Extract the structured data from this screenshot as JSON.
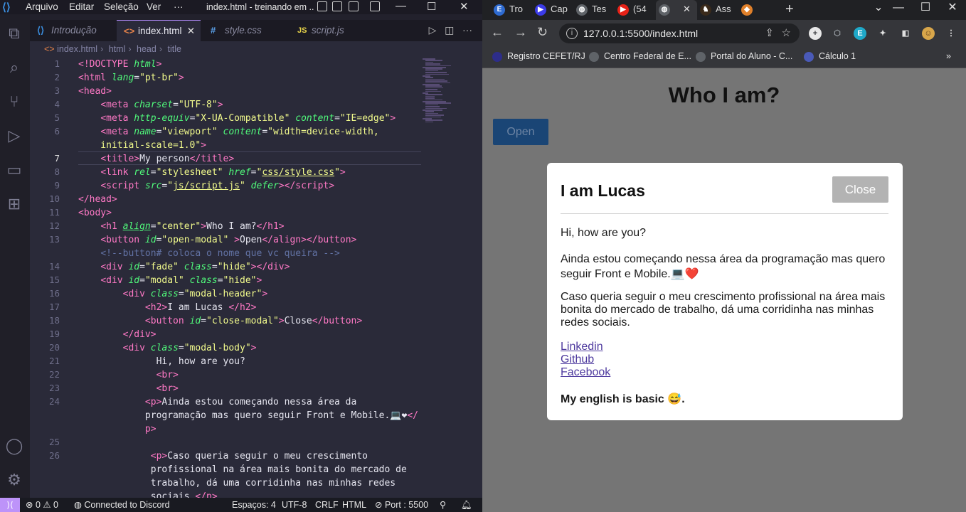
{
  "vscode": {
    "menu": [
      "Arquivo",
      "Editar",
      "Seleção",
      "Ver",
      "···"
    ],
    "window_title": "index.html - treinando em ...",
    "tabs": [
      {
        "label": "Introdução",
        "icon": "vscode-logo-icon"
      },
      {
        "label": "index.html",
        "icon": "html-icon"
      },
      {
        "label": "style.css",
        "icon": "hash-icon"
      },
      {
        "label": "script.js",
        "icon": "js-icon"
      }
    ],
    "tab_icons": {
      "html": "<>",
      "css": "#",
      "js": "JS"
    },
    "breadcrumb": [
      "index.html",
      "html",
      "head",
      "title"
    ],
    "line_numbers": [
      "1",
      "2",
      "3",
      "4",
      "5",
      "6",
      "7",
      "8",
      "9",
      "10",
      "11",
      "12",
      "13",
      "14",
      "15",
      "16",
      "17",
      "18",
      "19",
      "20",
      "21",
      "22",
      "23",
      "24",
      "25",
      "26"
    ],
    "current_line": "7",
    "status": {
      "problems": "⊗ 0 ⚠ 0",
      "discord": "Connected to Discord",
      "spaces": "Espaços: 4",
      "encoding": "UTF-8",
      "eol": "CRLF",
      "language": "HTML",
      "port": "Port : 5500"
    }
  },
  "browser": {
    "tabs": [
      {
        "label": "Tro",
        "color": "#2e6bd1",
        "glyph": "E"
      },
      {
        "label": "Cap",
        "color": "#3b3be8",
        "glyph": "▶"
      },
      {
        "label": "Tes",
        "color": "#5f6368",
        "glyph": "◍"
      },
      {
        "label": "(54",
        "color": "#e62117",
        "glyph": "▶"
      },
      {
        "label": "",
        "color": "#5f6368",
        "glyph": "◍"
      },
      {
        "label": "Ass",
        "color": "#3a2a1a",
        "glyph": "♞"
      },
      {
        "label": "",
        "color": "#e0802a",
        "glyph": "◆"
      }
    ],
    "url": "127.0.0.1:5500/index.html",
    "bookmarks": [
      {
        "label": "Registro CEFET/RJ",
        "color": "#2d2d8a"
      },
      {
        "label": "Centro Federal de E...",
        "color": "#5f6368"
      },
      {
        "label": "Portal do Aluno - C...",
        "color": "#5f6368"
      },
      {
        "label": "Cálculo 1",
        "color": "#4a5ab8"
      }
    ],
    "page": {
      "heading": "Who I am?",
      "open_button": "Open",
      "modal": {
        "title": "I am Lucas",
        "close_button": "Close",
        "greeting": "Hi, how are you?",
        "p1": "Ainda estou começando nessa área da programação mas quero seguir Front e Mobile.💻❤️",
        "p2": "Caso queria seguir o meu crescimento profissional na área mais bonita do mercado de trabalho, dá uma corridinha nas minhas redes sociais.",
        "links": [
          "Linkedin",
          "Github",
          "Facebook"
        ],
        "footer": "My english is basic 😅."
      }
    }
  }
}
